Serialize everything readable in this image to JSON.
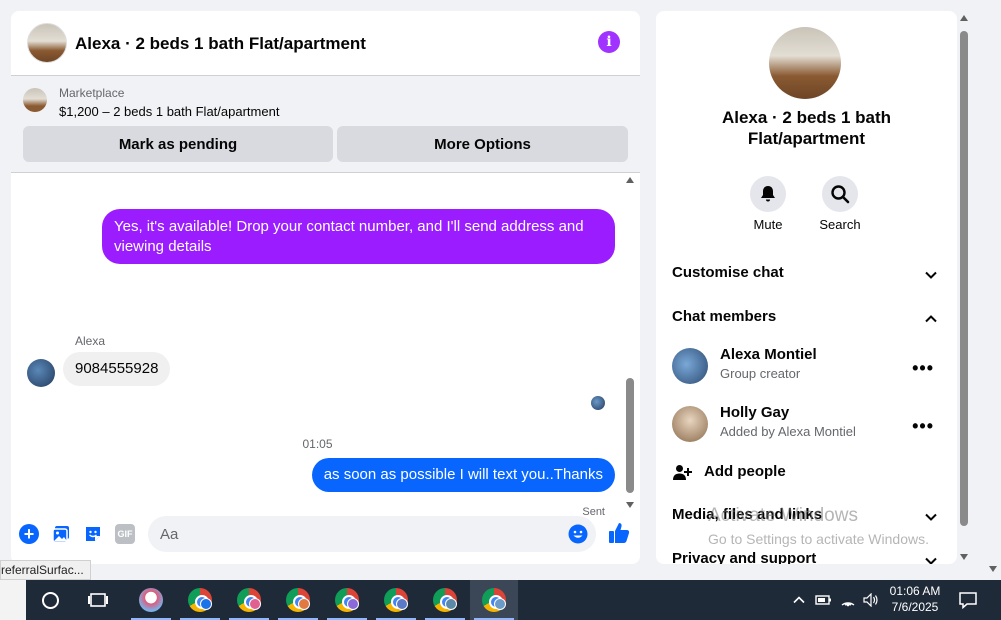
{
  "chat": {
    "title": "Alexa · 2 beds 1 bath Flat/apartment",
    "marketplace_label": "Marketplace",
    "listing": "$1,200 – 2 beds 1 bath Flat/apartment",
    "mark_pending": "Mark as pending",
    "more_options": "More Options",
    "messages": {
      "outgoing_1": "Yes, it's available! Drop your contact number, and I'll send address and viewing details",
      "sender": "Alexa",
      "incoming_1": "9084555928",
      "time": "01:05",
      "outgoing_2": "as soon as possible I will text you..Thanks",
      "status": "Sent"
    },
    "input_placeholder": "Aa",
    "gif_label": "GIF"
  },
  "tooltip": "referralSurfac...",
  "info": {
    "title": "Alexa · 2 beds 1 bath Flat/apartment",
    "mute": "Mute",
    "search": "Search",
    "customise_chat": "Customise chat",
    "chat_members": "Chat members",
    "members": [
      {
        "name": "Alexa Montiel",
        "role": "Group creator"
      },
      {
        "name": "Holly Gay",
        "role": "Added by Alexa Montiel"
      }
    ],
    "add_people": "Add people",
    "media": "Media, files and links",
    "privacy": "Privacy and support"
  },
  "watermark": {
    "line1": "Activate Windows",
    "line2": "Go to Settings to activate Windows."
  },
  "taskbar": {
    "time": "01:06 AM",
    "date": "7/6/2025"
  },
  "colors": {
    "accent_purple": "#8a0cff",
    "messenger_blue": "#0866ff"
  }
}
